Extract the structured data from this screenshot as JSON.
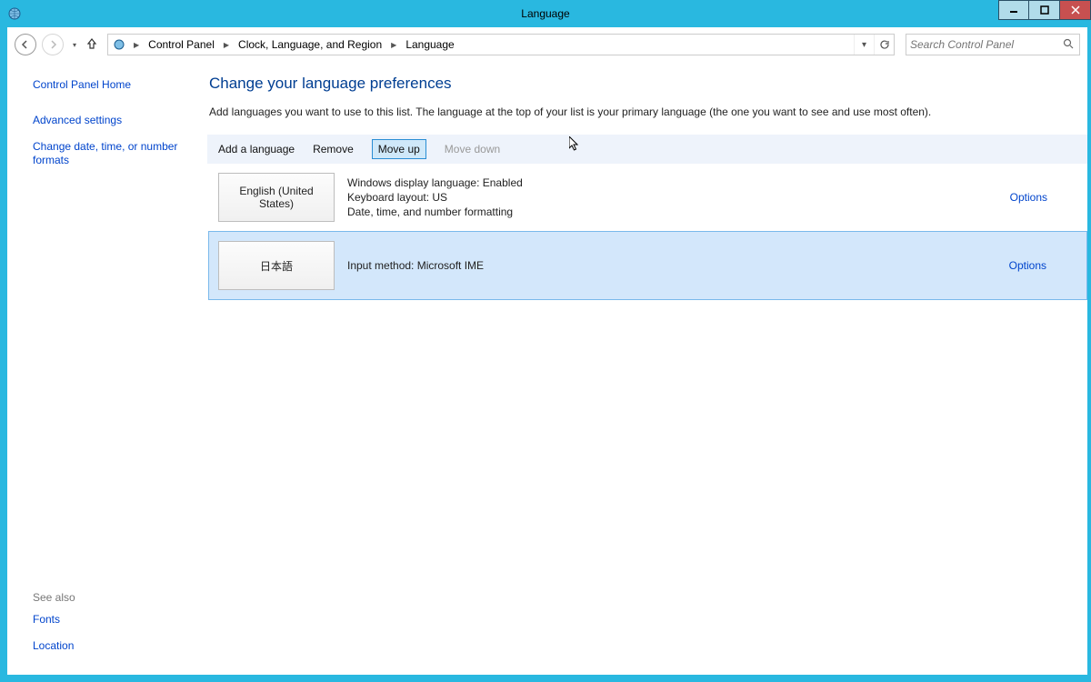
{
  "window": {
    "title": "Language"
  },
  "nav": {
    "breadcrumb": [
      "Control Panel",
      "Clock, Language, and Region",
      "Language"
    ],
    "search_placeholder": "Search Control Panel"
  },
  "sidebar": {
    "home": "Control Panel Home",
    "links": [
      "Advanced settings",
      "Change date, time, or number formats"
    ],
    "see_also_label": "See also",
    "see_also": [
      "Fonts",
      "Location"
    ]
  },
  "main": {
    "heading": "Change your language preferences",
    "description": "Add languages you want to use to this list. The language at the top of your list is your primary language (the one you want to see and use most often)."
  },
  "toolbar": {
    "add": "Add a language",
    "remove": "Remove",
    "move_up": "Move up",
    "move_down": "Move down"
  },
  "languages": [
    {
      "tile": "English (United States)",
      "lines": [
        "Windows display language: Enabled",
        "Keyboard layout: US",
        "Date, time, and number formatting"
      ],
      "options_label": "Options",
      "selected": false
    },
    {
      "tile": "日本語",
      "lines": [
        "Input method: Microsoft IME"
      ],
      "options_label": "Options",
      "selected": true
    }
  ]
}
